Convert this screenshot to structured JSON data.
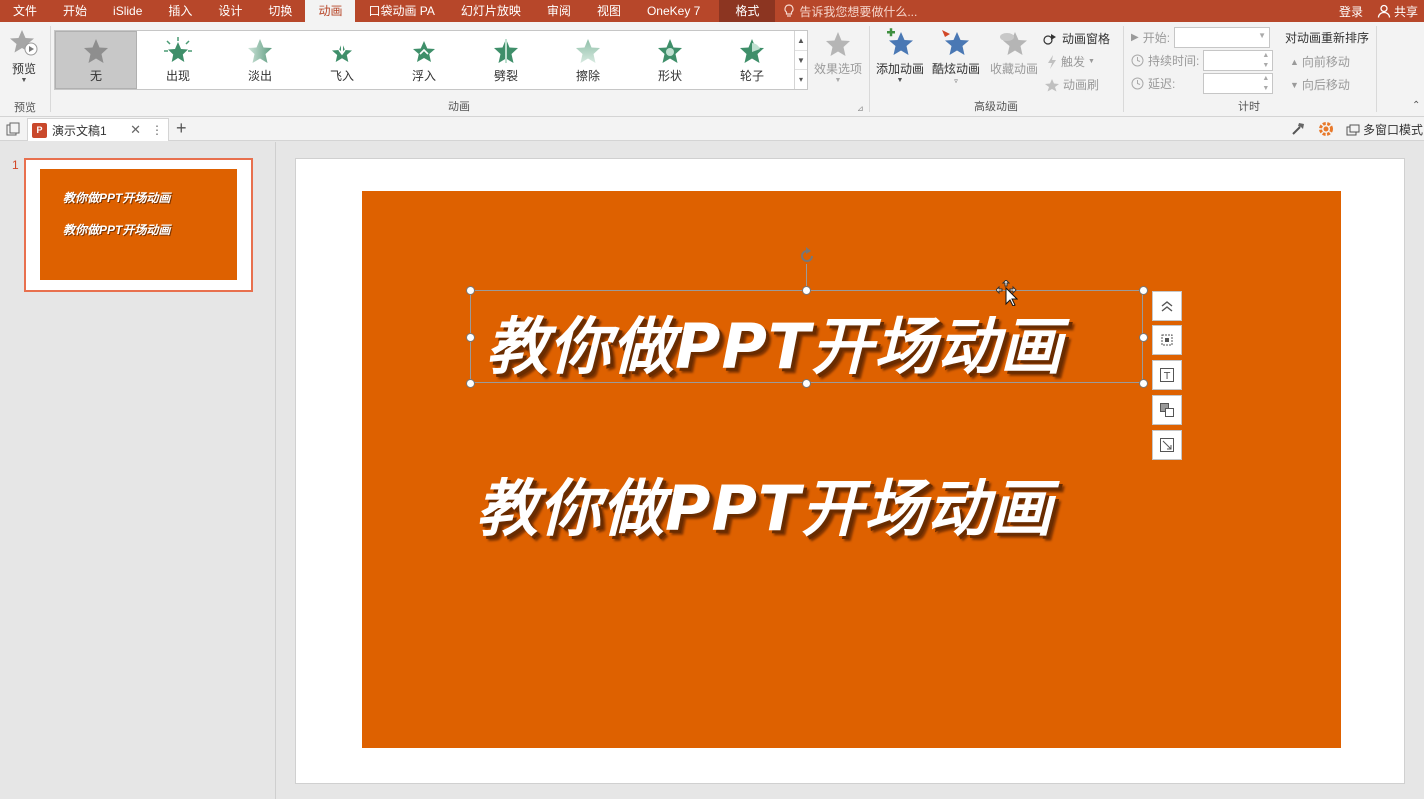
{
  "tabs": {
    "items": [
      "文件",
      "开始",
      "iSlide",
      "插入",
      "设计",
      "切换",
      "动画",
      "口袋动画 PA",
      "幻灯片放映",
      "审阅",
      "视图",
      "OneKey 7"
    ],
    "format": "格式",
    "tell_me": "告诉我您想要做什么...",
    "login": "登录",
    "share": "共享"
  },
  "ribbon": {
    "preview": {
      "label": "预览",
      "group": "预览"
    },
    "animation_group": "动画",
    "gallery": [
      "无",
      "出现",
      "淡出",
      "飞入",
      "浮入",
      "劈裂",
      "擦除",
      "形状",
      "轮子"
    ],
    "effect_options": "效果选项",
    "advanced": {
      "group": "高级动画",
      "add_animation": "添加动画",
      "cool_animation": "酷炫动画",
      "favorites": "收藏动画",
      "pane": "动画窗格",
      "trigger": "触发",
      "painter": "动画刷"
    },
    "timing": {
      "group": "计时",
      "start": "开始:",
      "duration": "持续时间:",
      "delay": "延迟:",
      "reorder": "对动画重新排序",
      "move_earlier": "向前移动",
      "move_later": "向后移动"
    }
  },
  "doc": {
    "tab_title": "演示文稿1",
    "multiwindow": "多窗口模式"
  },
  "slides": {
    "number": "1",
    "line1": "教你做PPT开场动画",
    "line2": "教你做PPT开场动画"
  },
  "colors": {
    "accent": "#b7472a",
    "slide_bg": "#de6100"
  }
}
